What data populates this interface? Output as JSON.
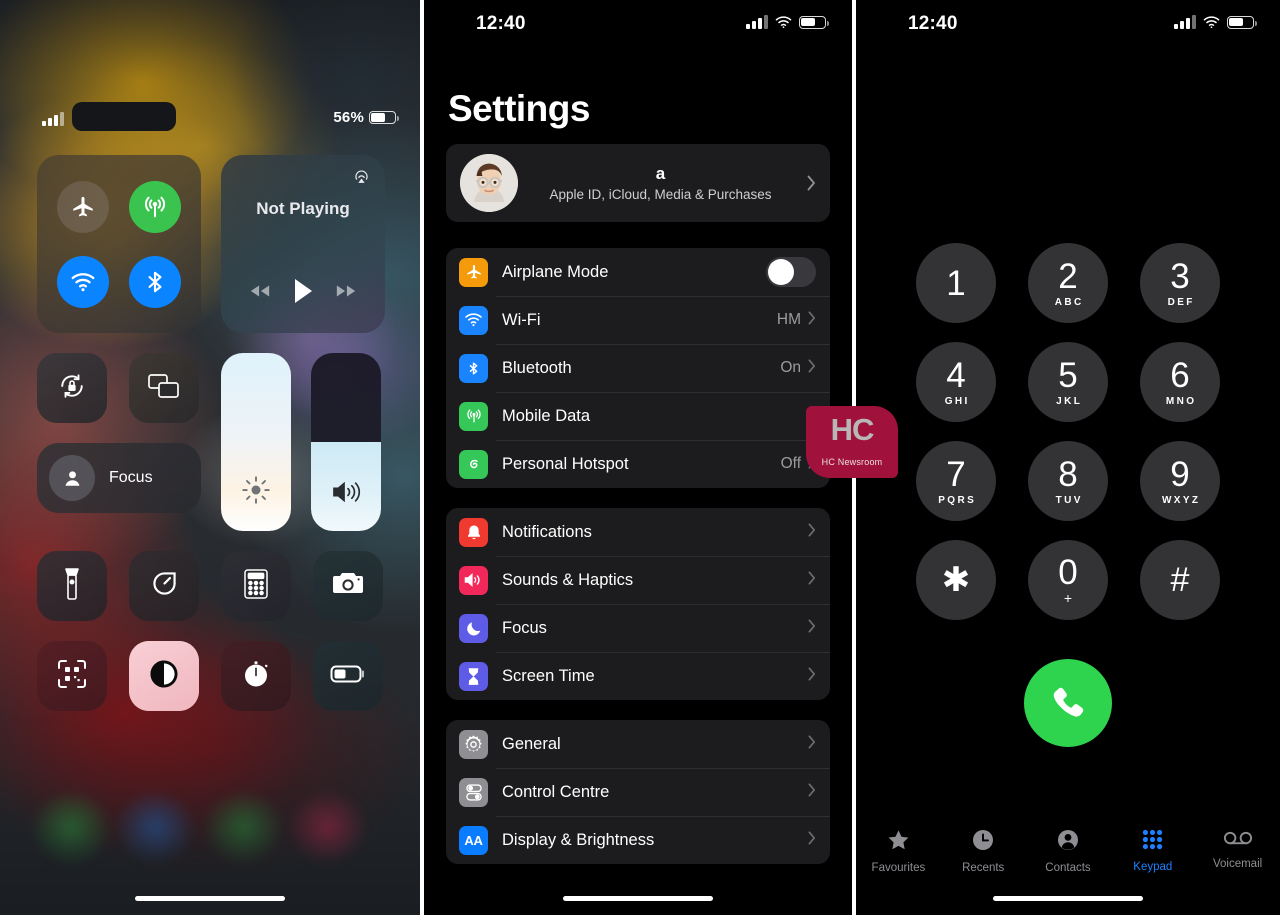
{
  "control_centre": {
    "status": {
      "carrier_redacted": true,
      "battery_percent_label": "56%",
      "battery_level": 56,
      "signal_bars_filled": 3
    },
    "connectivity": {
      "airplane_mode": {
        "label": "airplane-mode",
        "state": "off"
      },
      "mobile_data": {
        "label": "mobile-data",
        "state": "on"
      },
      "wifi": {
        "label": "wi-fi",
        "state": "on"
      },
      "bluetooth": {
        "label": "bluetooth",
        "state": "on"
      }
    },
    "media": {
      "title": "Not Playing",
      "airplay": "airplay-icon",
      "prev": "rewind",
      "play": "play",
      "next": "fast-forward"
    },
    "tiles": {
      "rotation_lock": "rotation-lock",
      "screen_mirroring": "screen-mirroring",
      "focus_label": "Focus"
    },
    "sliders": {
      "brightness": {
        "name": "brightness",
        "value": 100
      },
      "volume": {
        "name": "volume",
        "value": 50
      }
    },
    "shortcuts_row1": [
      "flashlight",
      "timer",
      "calculator",
      "camera"
    ],
    "shortcuts_row2": [
      "code-scanner",
      "dark-mode",
      "alarm",
      "low-power-mode"
    ],
    "dark_mode_active": true
  },
  "settings": {
    "status": {
      "time": "12:40",
      "signal_bars_filled": 3,
      "battery_level": 56
    },
    "title": "Settings",
    "account": {
      "name": "a",
      "subtitle": "Apple ID, iCloud, Media & Purchases",
      "avatar": "memoji-avatar"
    },
    "group1": [
      {
        "label": "Airplane Mode",
        "icon": "airplane-icon",
        "icon_color": "#f59b0b",
        "control": "toggle",
        "value": ""
      },
      {
        "label": "Wi-Fi",
        "icon": "wifi-icon",
        "icon_color": "#1a84ff",
        "control": "chevron",
        "value": "HM"
      },
      {
        "label": "Bluetooth",
        "icon": "bluetooth-icon",
        "icon_color": "#1a84ff",
        "control": "chevron",
        "value": "On"
      },
      {
        "label": "Mobile Data",
        "icon": "mobile-data-icon",
        "icon_color": "#36c759",
        "control": "chevron",
        "value": ""
      },
      {
        "label": "Personal Hotspot",
        "icon": "personal-hotspot-icon",
        "icon_color": "#36c759",
        "control": "chevron",
        "value": "Off"
      }
    ],
    "group2": [
      {
        "label": "Notifications",
        "icon": "notifications-icon",
        "icon_color": "#f03a2f",
        "control": "chevron",
        "value": ""
      },
      {
        "label": "Sounds & Haptics",
        "icon": "sounds-icon",
        "icon_color": "#f2285a",
        "control": "chevron",
        "value": ""
      },
      {
        "label": "Focus",
        "icon": "focus-moon-icon",
        "icon_color": "#5e5ce6",
        "control": "chevron",
        "value": ""
      },
      {
        "label": "Screen Time",
        "icon": "screen-time-icon",
        "icon_color": "#5e5ce6",
        "control": "chevron",
        "value": ""
      }
    ],
    "group3": [
      {
        "label": "General",
        "icon": "gear-icon",
        "icon_color": "#8e8e93",
        "control": "chevron",
        "value": ""
      },
      {
        "label": "Control Centre",
        "icon": "control-centre-icon",
        "icon_color": "#8e8e93",
        "control": "chevron",
        "value": ""
      },
      {
        "label": "Display & Brightness",
        "icon": "display-aa-icon",
        "icon_color": "#0a7cff",
        "control": "chevron",
        "value": "AA"
      }
    ]
  },
  "phone": {
    "status": {
      "time": "12:40",
      "signal_bars_filled": 3,
      "battery_level": 56
    },
    "keys": [
      {
        "num": "1",
        "letters": ""
      },
      {
        "num": "2",
        "letters": "ABC"
      },
      {
        "num": "3",
        "letters": "DEF"
      },
      {
        "num": "4",
        "letters": "GHI"
      },
      {
        "num": "5",
        "letters": "JKL"
      },
      {
        "num": "6",
        "letters": "MNO"
      },
      {
        "num": "7",
        "letters": "PQRS"
      },
      {
        "num": "8",
        "letters": "TUV"
      },
      {
        "num": "9",
        "letters": "WXYZ"
      },
      {
        "num": "✱",
        "letters": ""
      },
      {
        "num": "0",
        "letters": "+"
      },
      {
        "num": "#",
        "letters": ""
      }
    ],
    "call_button": "call-button",
    "tabs": [
      {
        "label": "Favourites",
        "icon": "star-icon",
        "active": false
      },
      {
        "label": "Recents",
        "icon": "clock-icon",
        "active": false
      },
      {
        "label": "Contacts",
        "icon": "person-icon",
        "active": false
      },
      {
        "label": "Keypad",
        "icon": "keypad-icon",
        "active": true
      },
      {
        "label": "Voicemail",
        "icon": "voicemail-icon",
        "active": false
      }
    ],
    "accent_color": "#1e7fff"
  },
  "watermark": {
    "logo": "HC",
    "text": "HC Newsroom",
    "color": "#a0123c"
  }
}
